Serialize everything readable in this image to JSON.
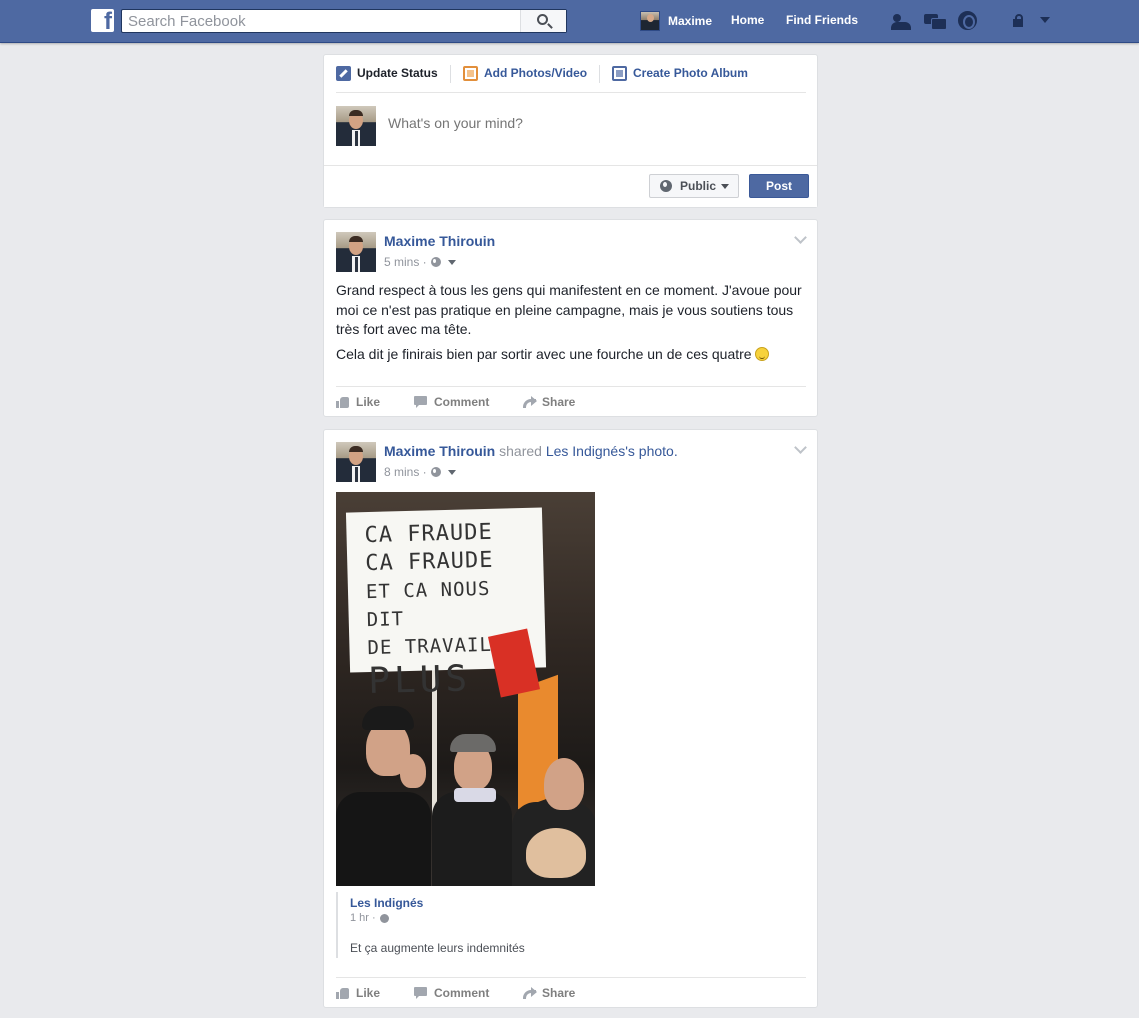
{
  "topbar": {
    "search_placeholder": "Search Facebook",
    "user_name": "Maxime",
    "home_label": "Home",
    "find_friends_label": "Find Friends",
    "brand_color": "#4e69a2"
  },
  "composer": {
    "tabs": [
      "Update Status",
      "Add Photos/Video",
      "Create Photo Album"
    ],
    "placeholder": "What's on your mind?",
    "privacy_label": "Public",
    "post_label": "Post"
  },
  "posts": [
    {
      "author": "Maxime Thirouin",
      "time": "5 mins ·",
      "paragraphs": [
        "Grand respect à tous les gens qui manifestent en ce moment. J'avoue pour moi ce n'est pas pratique en pleine campagne, mais je vous soutiens tous très fort avec ma tête.",
        "Cela dit je finirais bien par sortir avec une fourche un de ces quatre"
      ],
      "actions": [
        "Like",
        "Comment",
        "Share"
      ]
    },
    {
      "author": "Maxime Thirouin",
      "shared_word": "shared",
      "shared_page": "Les Indignés",
      "shared_suffix": "'s photo.",
      "time": "8 mins ·",
      "photo_sign": {
        "line1": "CA FRAUDE",
        "line2": "CA FRAUDE",
        "line3": "ET CA NOUS DIT",
        "line4": "DE TRAVAILLER",
        "line5": "PLUS"
      },
      "quote": {
        "author": "Les Indignés",
        "time": "1 hr ·",
        "text": "Et ça augmente leurs indemnités"
      },
      "actions": [
        "Like",
        "Comment",
        "Share"
      ]
    }
  ]
}
